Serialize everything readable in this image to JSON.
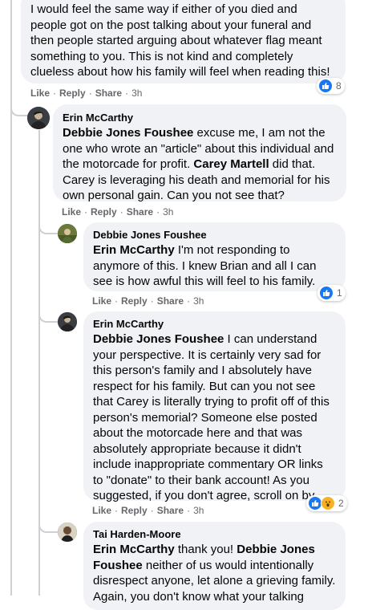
{
  "comment0": {
    "text": "I would feel the same way if either of you died and people got on the post talking about your funeral and then people started arguing about whatever flag meant something to you. This is not kind and completely clueless about how his family will feel when reading this!",
    "actions": {
      "like": "Like",
      "reply": "Reply",
      "share": "Share",
      "time": "3h"
    },
    "reaction_count": "8"
  },
  "comment1": {
    "author": "Erin McCarthy",
    "mention1": "Debbie Jones Foushee",
    "text1": " excuse me, I am not the one who wrote an \"article\" about this individual and the motorcade for profit. ",
    "mention2": "Carey Martell",
    "text2": " did that. Carey is leveraging his death and memorial for his own personal gain. Can you not see that?",
    "actions": {
      "like": "Like",
      "reply": "Reply",
      "share": "Share",
      "time": "3h"
    }
  },
  "comment2": {
    "author": "Debbie Jones Foushee",
    "mention": "Erin McCarthy",
    "text": " I'm not responding to anymore of this. I knew Brian and all I can see is how awful this will feel to his family.",
    "actions": {
      "like": "Like",
      "reply": "Reply",
      "share": "Share",
      "time": "3h"
    },
    "reaction_count": "1"
  },
  "comment3": {
    "author": "Erin McCarthy",
    "mention": "Debbie Jones Foushee",
    "text": " I can understand your perspective. It is certainly very sad for this person's family and I absolutely have respect for his family. But can you not see that Carey is literally trying to profit off of this person's memorial? Someone else posted about the motorcade here and that was absolutely appropriate because it didn't include inappropriate commentary OR links to \"donate\" to their bank account! As you suggested, if you don't agree, scroll on by.",
    "actions": {
      "like": "Like",
      "reply": "Reply",
      "share": "Share",
      "time": "3h"
    },
    "reaction_count": "2"
  },
  "comment4": {
    "author": "Tai Harden-Moore",
    "mention1": "Erin McCarthy",
    "text1": " thank you! ",
    "mention2": "Debbie Jones Foushee",
    "text2": " neither of us would intentionally disrespect anyone, let alone a grieving family. Again, you don't know what your talking"
  },
  "colors": {
    "bubble": "#f0f2f5",
    "meta": "#65676b",
    "like_blue": "#1877f2",
    "wow_yellow": "#f7b125",
    "thread_line": "#ced0d4"
  }
}
